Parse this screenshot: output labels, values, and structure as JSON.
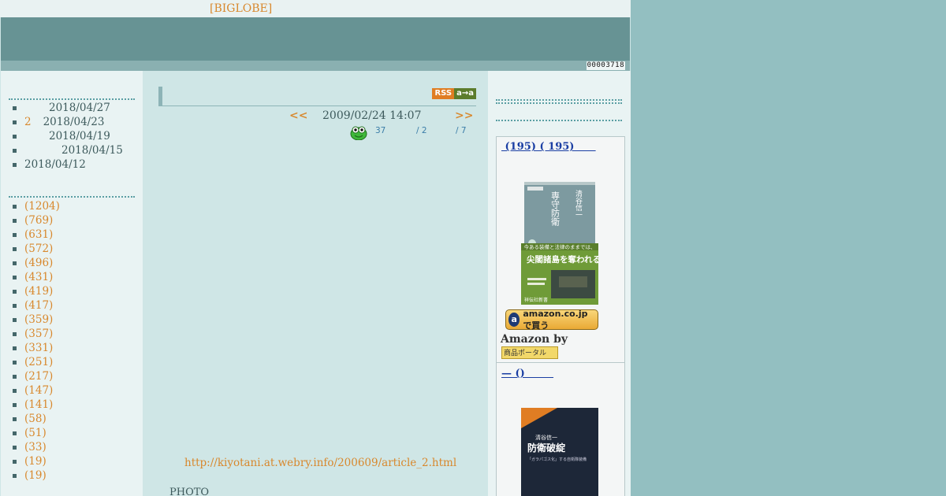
{
  "header": {
    "site_link": "[BIGLOBE]",
    "counter": "00003718"
  },
  "sidebar_left": {
    "recent": [
      {
        "count": "",
        "date": "2018/04/27"
      },
      {
        "count": "2",
        "date": "2018/04/23"
      },
      {
        "count": "",
        "date": "2018/04/19"
      },
      {
        "count": "",
        "date": "2018/04/15"
      },
      {
        "count": "",
        "date": "2018/04/12"
      }
    ],
    "categories": [
      "(1204)",
      "(769)",
      "(631)",
      "(572)",
      "(496)",
      "(431)",
      "(419)",
      "(417)",
      "(359)",
      "(357)",
      "(331)",
      "(251)",
      "(217)",
      "(147)",
      "(141)",
      "(58)",
      "(51)",
      "(33)",
      "(19)",
      "(19)"
    ]
  },
  "article": {
    "rss_label": "RSS",
    "rss_sub": "a→a",
    "prev": "<<",
    "timestamp": "2009/02/24 14:07",
    "next": ">>",
    "stat1": "37",
    "stat2": "/ 2",
    "stat3": "/ 7",
    "link": "http://kiyotani.at.webry.info/200609/article_2.html",
    "photo_label": "PHOTO"
  },
  "sidebar_right": {
    "book1_title": " (195) ( 195)      ",
    "amazon_button": "amazon.co.jp で買う",
    "amazon_by": "Amazon by",
    "portal_label": "商品ポータル",
    "book2_title": "— ()        ",
    "book1_cover": {
      "author": "清谷信一",
      "title": "専守防衛",
      "band_headline": "今ある装備と法律のままでは、",
      "band_main": "尖閣諸島を奪われる!",
      "publisher": "祥伝社新書"
    },
    "book2_cover": {
      "author": "清谷信一",
      "title": "防衛破綻",
      "subtitle": "「ガラパゴス化」する自衛隊装備"
    }
  },
  "colors": {
    "accent": "#d8882d",
    "banner": "#679394",
    "background": "#93bfc1",
    "link_blue": "#1a3ea3"
  }
}
